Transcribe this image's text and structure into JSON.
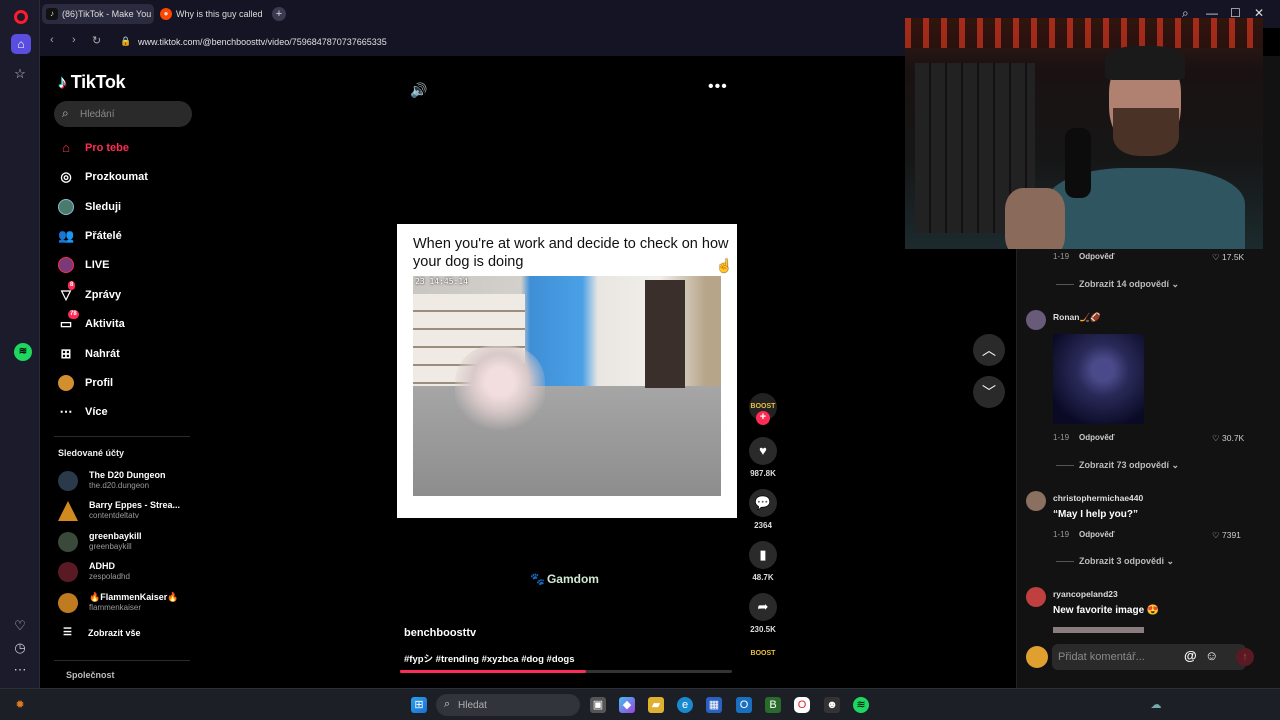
{
  "browser": {
    "tabs": [
      {
        "label": "(86)TikTok - Make You",
        "icon": "tiktok-favicon"
      },
      {
        "label": "Why is this guy called the",
        "icon": "reddit-favicon"
      }
    ],
    "url": "www.tiktok.com/@benchboosttv/video/7596847870737665335"
  },
  "sidebar": {
    "logo": "TikTok",
    "search_placeholder": "Hledání",
    "nav": [
      {
        "label": "Pro tebe",
        "icon": "home-icon"
      },
      {
        "label": "Prozkoumat",
        "icon": "compass-icon"
      },
      {
        "label": "Sleduji",
        "icon": "following-avatar-icon"
      },
      {
        "label": "Přátelé",
        "icon": "friends-icon"
      },
      {
        "label": "LIVE",
        "icon": "live-icon"
      },
      {
        "label": "Zprávy",
        "icon": "send-icon",
        "badge": "8"
      },
      {
        "label": "Aktivita",
        "icon": "activity-icon",
        "badge": "78"
      },
      {
        "label": "Nahrát",
        "icon": "upload-icon"
      },
      {
        "label": "Profil",
        "icon": "profile-avatar-icon"
      },
      {
        "label": "Více",
        "icon": "more-dots-icon"
      }
    ],
    "following_title": "Sledované účty",
    "accounts": [
      {
        "name": "The D20 Dungeon",
        "handle": "the.d20.dungeon"
      },
      {
        "name": "Barry Eppes - Strea...",
        "handle": "contentdeltatv"
      },
      {
        "name": "greenbaykill",
        "handle": "greenbaykill"
      },
      {
        "name": "ADHD",
        "handle": "zespoladhd"
      },
      {
        "name": "🔥FlammenKaiser🔥",
        "handle": "flammenkaiser"
      }
    ],
    "show_all": "Zobrazit vše",
    "company": "Společnost"
  },
  "video": {
    "meme_caption": "When you're at work and decide to check on how your dog is doing",
    "timestamp": "23 14:45:14",
    "sponsor": "Gamdom",
    "author": "benchboosttv",
    "tags": "#fypシ #trending #xyzbca #dog #dogs",
    "progress_percent": 56,
    "actions": {
      "likes": "987.8K",
      "comments": "2364",
      "saves": "48.7K",
      "shares": "230.5K"
    }
  },
  "comments": {
    "items": [
      {
        "date": "1-19",
        "reply": "Odpověď",
        "likes": "17.5K",
        "view_replies": "Zobrazit 14 odpovědí"
      },
      {
        "user": "Ronan🏒🏈",
        "date": "1-19",
        "reply": "Odpověď",
        "likes": "30.7K",
        "view_replies": "Zobrazit 73 odpovědí"
      },
      {
        "user": "christophermichae440",
        "text": "“May I help you?”",
        "date": "1-19",
        "reply": "Odpověď",
        "likes": "7391",
        "view_replies": "Zobrazit 3 odpovědi"
      },
      {
        "user": "ryancopeland23",
        "text": "New favorite image 😍"
      }
    ],
    "input_placeholder": "Přidat komentář..."
  },
  "taskbar": {
    "search_placeholder": "Hledat"
  },
  "colors": {
    "accent": "#fe2c55",
    "bg": "#000000",
    "panel": "#121212"
  }
}
